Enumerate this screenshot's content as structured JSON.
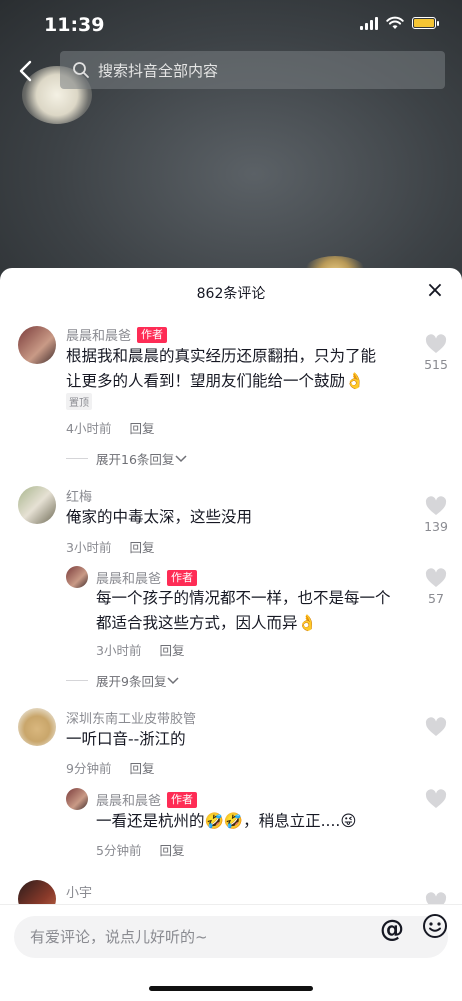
{
  "status_bar": {
    "time": "11:39"
  },
  "search": {
    "placeholder": "搜索抖音全部内容"
  },
  "sheet": {
    "title": "862条评论",
    "close": "×"
  },
  "comments": [
    {
      "name": "晨晨和晨爸",
      "author_tag": "作者",
      "text_line1": "根据我和晨晨的真实经历还原翻拍，只为了能",
      "text_line2": "让更多的人看到！望朋友们能给一个鼓励👌",
      "pin": "置顶",
      "time": "4小时前",
      "reply": "回复",
      "likes": "515",
      "expand": "展开16条回复"
    },
    {
      "name": "红梅",
      "text_line1": "俺家的中毒太深，这些没用",
      "time": "3小时前",
      "reply": "回复",
      "likes": "139",
      "sub": {
        "name": "晨晨和晨爸",
        "author_tag": "作者",
        "text_line1": "每一个孩子的情况都不一样，也不是每一个",
        "text_line2": "都适合我这些方式，因人而异👌",
        "time": "3小时前",
        "reply": "回复",
        "likes": "57"
      },
      "expand": "展开9条回复"
    },
    {
      "name": "深圳东南工业皮带胶管",
      "text_line1": "一听口音--浙江的",
      "time": "9分钟前",
      "reply": "回复",
      "sub": {
        "name": "晨晨和晨爸",
        "author_tag": "作者",
        "text_line1": "一看还是杭州的🤣🤣，稍息立正....😜",
        "time": "5分钟前",
        "reply": "回复"
      }
    },
    {
      "name": "小宇"
    }
  ],
  "input": {
    "placeholder": "有爱评论，说点儿好听的~",
    "at": "@"
  },
  "colors": {
    "author_tag": "#fe2c55",
    "battery": "#f5c534"
  }
}
